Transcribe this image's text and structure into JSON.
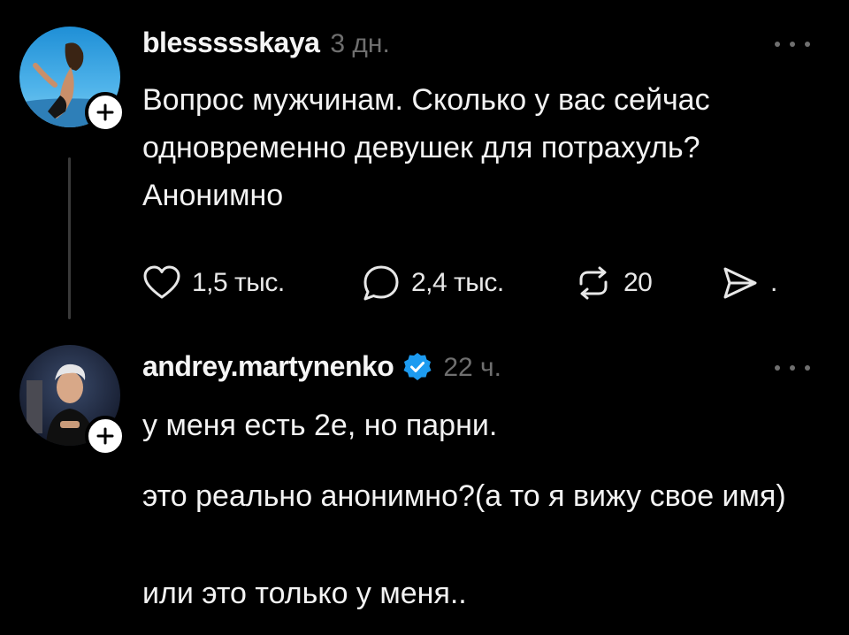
{
  "posts": [
    {
      "username": "blesssssk​aya",
      "time": "3 дн.",
      "text": "Вопрос мужчинам. Сколько у вас сейчас одновременно девушек для потрахуль? Анонимно",
      "actions": {
        "likes": "1,5 тыс.",
        "replies": "2,4 тыс.",
        "reposts": "20"
      },
      "share_suffix": "."
    },
    {
      "username": "andrey.martynenko",
      "verified": true,
      "time": "22 ч.",
      "lines": [
        "у меня есть 2е, но парни.",
        "это реально анонимно?(а то я вижу свое имя)",
        "или это только у меня.."
      ]
    }
  ],
  "icons": {
    "like": "heart-icon",
    "reply": "speech-bubble-icon",
    "repost": "repost-arrows-icon",
    "share": "send-icon",
    "more": "more-dots-icon",
    "follow": "plus-icon",
    "verified": "verified-badge-icon"
  },
  "colors": {
    "background": "#000000",
    "text": "#f3f3f3",
    "muted": "#6f6f6f",
    "verified": "#1d9bf0"
  }
}
